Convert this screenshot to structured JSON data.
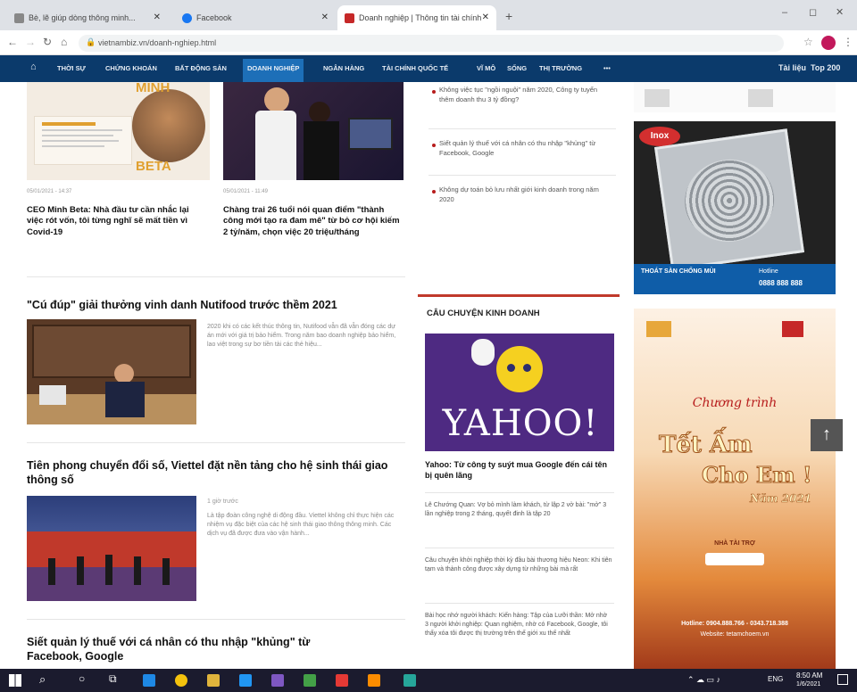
{
  "browser": {
    "tabs": [
      {
        "label": "Bè, lẽ giúp dòng thông minh...",
        "fav": "#888"
      },
      {
        "label": "Facebook",
        "fav": "#1877f2"
      },
      {
        "label": "Doanh nghiệp | Thông tin tài chính",
        "fav": "#c62828"
      }
    ],
    "url": "vietnambiz.vn/doanh-nghiep.html"
  },
  "nav": {
    "items": [
      "THỜI SỰ",
      "CHỨNG KHOÁN",
      "BẤT ĐỘNG SẢN",
      "DOANH NGHIỆP",
      "NGÂN HÀNG",
      "TÀI CHÍNH QUỐC TẾ",
      "VĨ MÔ",
      "SỐNG",
      "THỊ TRƯỜNG",
      "•••"
    ],
    "right": [
      "Tài liệu",
      "Top 200"
    ]
  },
  "top": {
    "left": {
      "meta": "05/01/2021 - 14:37",
      "title": "CEO Minh Beta: Nhà đầu tư cần nhắc lại việc rót vốn, tôi từng nghĩ sẽ mất tiền vì Covid-19",
      "img_text_1": "MINH",
      "img_text_2": "BETA"
    },
    "mid": {
      "meta": "05/01/2021 - 11:49",
      "title": "Chàng trai 26 tuổi nói quan điểm \"thành công mới tạo ra đam mê\" từ bỏ cơ hội kiếm 2 tỷ/năm, chọn việc 20 triệu/tháng"
    },
    "right_list": [
      "Không việc tục \"ngồi nguội\" năm 2020, Công ty tuyển thêm doanh thu 3 tỷ đồng?",
      "Siết quản lý thuế với cá nhân có thu nhập \"khủng\" từ Facebook, Google",
      "Không dự toán bỏ lưu nhất giới kinh doanh trong năm 2020"
    ]
  },
  "articles": [
    {
      "title": "\"Cú đúp\" giải thưởng vinh danh Nutifood trước thềm 2021",
      "sapo": "2020 khi có các kết thúc thông tin, Nutifood vẫn đã vẫn đóng các dự án mới với giá trị bảo hiểm. Trong năm bao doanh nghiệp bảo hiểm, lao việt trong sự bơ tiền tài các thẻ hiệu...",
      "meta": ""
    },
    {
      "title": "Tiên phong chuyển đổi số, Viettel đặt nền tảng cho hệ sinh thái giao thông số",
      "sapo": "Là tập đoàn công nghệ di động đầu. Viettel không chỉ thực hiện các nhiệm vụ đặc biệt của các hệ sinh thái giao thông thông minh. Các dịch vụ đã được đưa vào vận hành...",
      "meta": "1 giờ trước"
    },
    {
      "title": "Siết quản lý thuế với cá nhân có thu nhập \"khủng\" từ Facebook, Google",
      "sapo": "",
      "meta": ""
    }
  ],
  "business": {
    "heading": "CÂU CHUYỆN KINH DOANH",
    "logo": "YAHOO!",
    "title": "Yahoo: Từ công ty suýt mua Google đến cái tên bị quên lãng",
    "items": [
      "Lê Chướng Quan: Vợ bỏ mình làm khách, từ lập 2 vở bài: \"mở\" 3 lần nghiệp trong 2 tháng, quyết đinh là tập 20",
      "Câu chuyện khởi nghiệp thời kỳ đầu bài thương hiệu Neon: Khi tiên tạm và thành công được xây dựng từ những bài mà rất",
      "Bài học nhớ người khách: Kiến hàng: Tập của Lưỡi thần: Mở nhờ 3 người khởi nghiệp: Quan nghiệm, nhờ có Facebook, Google, tôi thấy xóa tôi được thị trường trên thế giới xu thế nhất"
    ]
  },
  "ads": {
    "ad1": {
      "brand": "Inox",
      "line1": "THOÁT SÀN CHỐNG MÙI",
      "line2": "Hotline",
      "phone": "0888 888 888"
    },
    "ad2": {
      "title1": "Chương trình",
      "title2": "Tết Ấm",
      "title3": "Cho Em !",
      "year": "Năm 2021",
      "sponsor": "NHÀ TÀI TRỢ",
      "hotline": "Hotline: 0904.888.766 - 0343.718.388",
      "site": "Website: tetamchoem.vn"
    }
  },
  "colors": {
    "nav": "#0b3a6b",
    "nav_active": "#1d6fb8",
    "accent": "#c0392b"
  },
  "taskbar": {
    "clock": "8:50 AM",
    "date": "1/6/2021",
    "lang": "ENG"
  }
}
